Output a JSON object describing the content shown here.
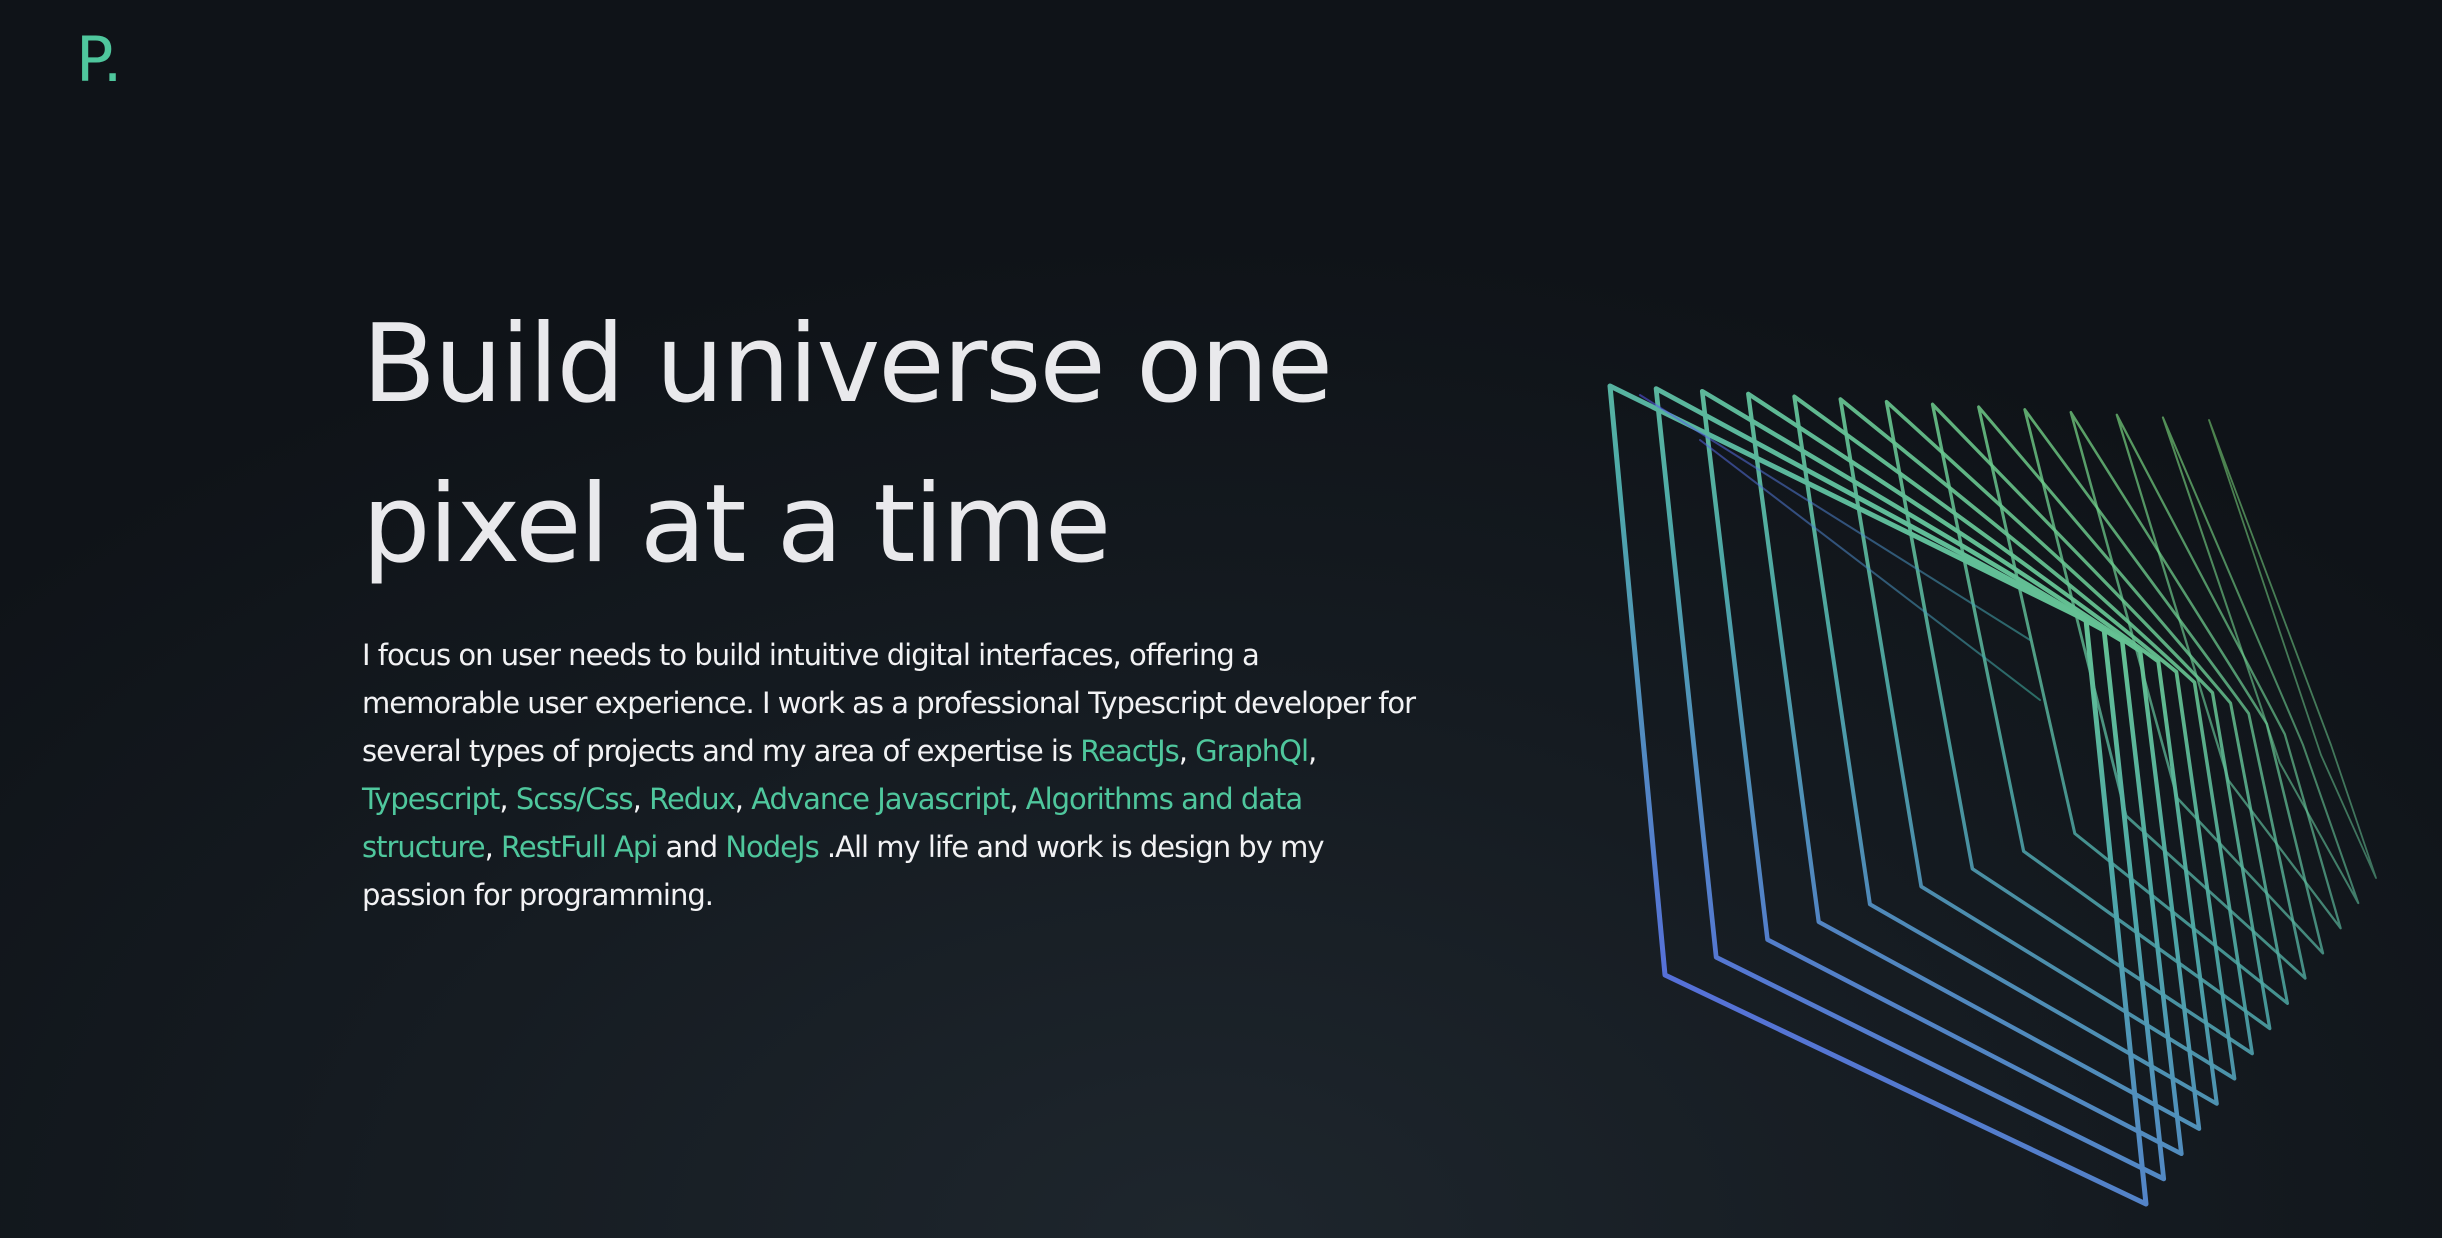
{
  "logo": {
    "text": "P."
  },
  "hero": {
    "headline_line1": "Build universe one",
    "headline_line2": "pixel at a time",
    "bio": {
      "intro": "I focus on user needs to build intuitive digital interfaces, offering a memorable user experience. I work as a professional Typescript developer for several types of projects and my area of expertise is ",
      "skills": [
        "ReactJs",
        "GraphQl",
        "Typescript",
        "Scss/Css",
        "Redux",
        "Advance Javascript",
        "Algorithms and data structure",
        "RestFull Api",
        "NodeJs"
      ],
      "separator": ", ",
      "and_word": " and ",
      "outro": " .All my life and work is design by my passion for programming."
    }
  },
  "decoration": {
    "icon": "wireframe-layered-cube-icon",
    "color_start": "#5a52f2",
    "color_mid": "#4ea9a8",
    "color_end": "#8ff06c"
  }
}
